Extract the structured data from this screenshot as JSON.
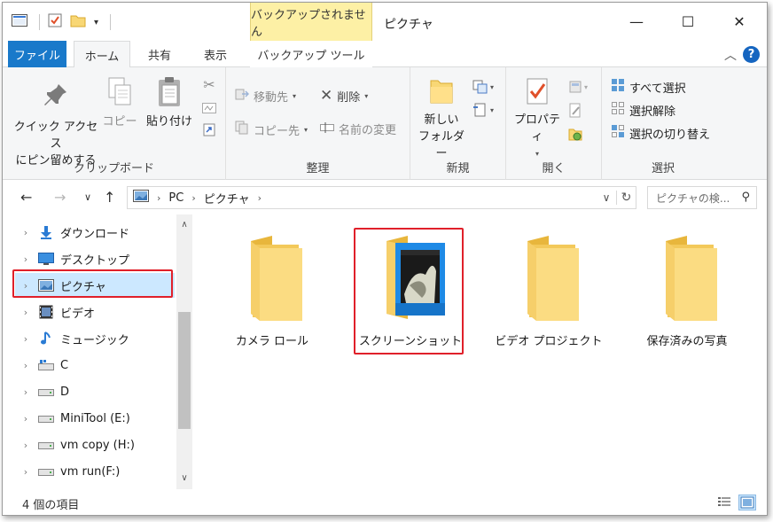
{
  "window": {
    "title": "ピクチャ",
    "context_tab": "バックアップされません",
    "controls": {
      "minimize": "—",
      "maximize": "☐",
      "close": "✕"
    }
  },
  "tabs": [
    {
      "label": "ファイル"
    },
    {
      "label": "ホーム"
    },
    {
      "label": "共有"
    },
    {
      "label": "表示"
    },
    {
      "label": "バックアップ ツール"
    }
  ],
  "ribbon": {
    "clipboard": {
      "label": "クリップボード",
      "pin_line1": "クイック アクセス",
      "pin_line2": "にピン留めする",
      "copy": "コピー",
      "paste": "貼り付け"
    },
    "organize": {
      "label": "整理",
      "move_to": "移動先",
      "copy_to": "コピー先",
      "delete": "削除",
      "rename": "名前の変更"
    },
    "new": {
      "label": "新規",
      "new_folder_line1": "新しい",
      "new_folder_line2": "フォルダー"
    },
    "open": {
      "label": "開く",
      "properties": "プロパティ"
    },
    "select": {
      "label": "選択",
      "select_all": "すべて選択",
      "select_none": "選択解除",
      "invert": "選択の切り替え"
    }
  },
  "address": {
    "crumbs": [
      "PC",
      "ピクチャ"
    ],
    "search_placeholder": "ピクチャの検..."
  },
  "nav_tree": [
    {
      "label": "ダウンロード",
      "icon": "download-arrow-icon"
    },
    {
      "label": "デスクトップ",
      "icon": "desktop-icon"
    },
    {
      "label": "ピクチャ",
      "icon": "pictures-icon",
      "selected": true
    },
    {
      "label": "ビデオ",
      "icon": "video-icon"
    },
    {
      "label": "ミュージック",
      "icon": "music-note-icon"
    },
    {
      "label": "C",
      "icon": "windows-drive-icon"
    },
    {
      "label": "D",
      "icon": "drive-icon"
    },
    {
      "label": "MiniTool (E:)",
      "icon": "drive-icon"
    },
    {
      "label": "vm copy (H:)",
      "icon": "drive-icon"
    },
    {
      "label": "vm run(F:)",
      "icon": "drive-icon"
    }
  ],
  "folders": [
    {
      "label": "カメラ ロール"
    },
    {
      "label": "スクリーンショット",
      "thumbnail": true
    },
    {
      "label": "ビデオ プロジェクト"
    },
    {
      "label": "保存済みの写真"
    }
  ],
  "status": {
    "item_count": "4 個の項目"
  },
  "colors": {
    "file_tab": "#1979ca",
    "context_tab": "#fdf0a5",
    "selection": "#cce8ff",
    "highlight": "#e0202a",
    "folder": "#f8d775"
  }
}
